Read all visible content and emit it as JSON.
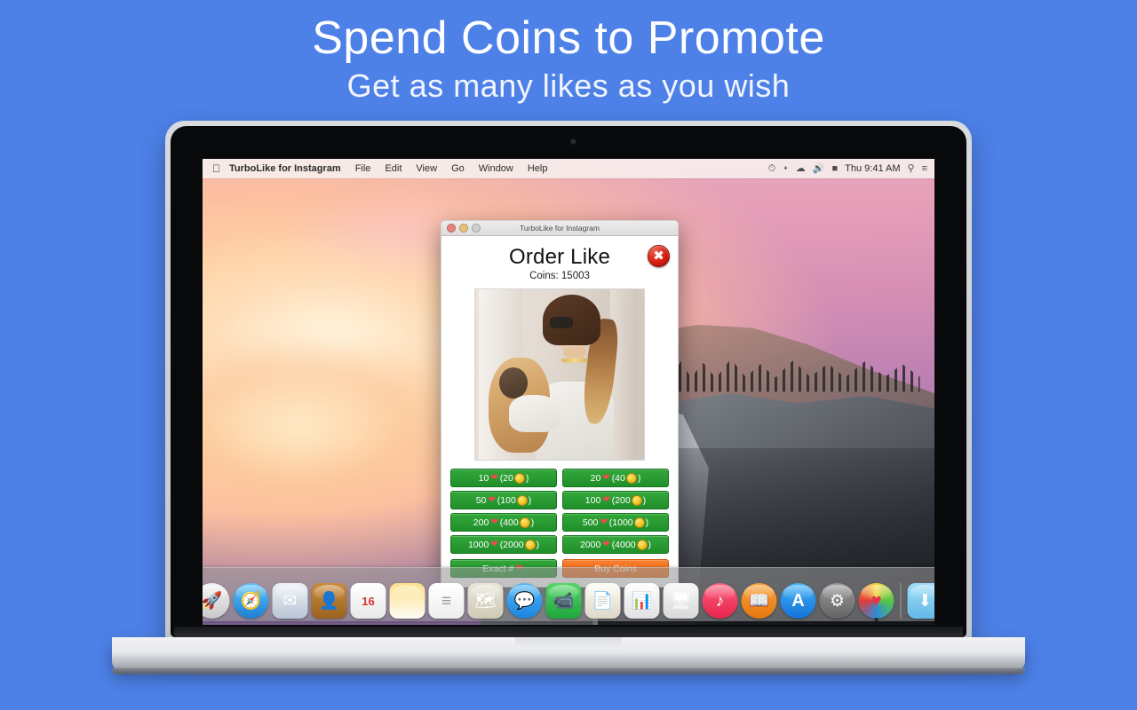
{
  "headline": {
    "line1": "Spend Coins to Promote",
    "line2": "Get as many likes as you wish"
  },
  "colors": {
    "background": "#4d81e8",
    "button_green": "#2a9c33",
    "button_orange": "#f4721d",
    "heart_red": "#ef4b4b",
    "coin_gold": "#f2c31f",
    "close_red": "#d81f12"
  },
  "menubar": {
    "apple": "",
    "app_name": "TurboLike for Instagram",
    "items": [
      "File",
      "Edit",
      "View",
      "Go",
      "Window",
      "Help"
    ],
    "status_icons": [
      "time-machine-icon",
      "bluetooth-icon",
      "wifi-icon",
      "volume-icon",
      "battery-icon"
    ],
    "clock": "Thu 9:41 AM",
    "right_icons": [
      "spotlight-search-icon",
      "notification-center-icon"
    ]
  },
  "window": {
    "title": "TurboLike for Instagram",
    "traffic_lights": [
      "close",
      "minimize",
      "zoom"
    ],
    "heading": "Order Like",
    "coins_label": "Coins: 15003",
    "close_button": "✖",
    "photo_alt": "woman with sunglasses and ponytail holding a small dog"
  },
  "order_options": [
    {
      "likes": "10",
      "price": "20",
      "left": "10",
      "right": "(20",
      "tail": ")"
    },
    {
      "likes": "20",
      "price": "40",
      "left": "20",
      "right": "(40",
      "tail": ")"
    },
    {
      "likes": "50",
      "price": "100",
      "left": "50",
      "right": "(100",
      "tail": ")"
    },
    {
      "likes": "100",
      "price": "200",
      "left": "100",
      "right": "(200",
      "tail": ")"
    },
    {
      "likes": "200",
      "price": "400",
      "left": "200",
      "right": "(400",
      "tail": ")"
    },
    {
      "likes": "500",
      "price": "1000",
      "left": "500",
      "right": "(1000",
      "tail": ")"
    },
    {
      "likes": "1000",
      "price": "2000",
      "left": "1000",
      "right": "(2000",
      "tail": ")"
    },
    {
      "likes": "2000",
      "price": "4000",
      "left": "2000",
      "right": "(4000",
      "tail": ")"
    }
  ],
  "actions": {
    "exact_label": "Exact  #",
    "buy_coins_label": "Buy Coins"
  },
  "dock": {
    "items": [
      {
        "name": "finder",
        "glyph": "☺",
        "bg": "linear-gradient(180deg,#3da8f5,#1b7fd6)",
        "shape": "rounded"
      },
      {
        "name": "launchpad",
        "glyph": "🚀",
        "bg": "linear-gradient(180deg,#f2f2f2,#c9c9c9)",
        "shape": "circle"
      },
      {
        "name": "safari",
        "glyph": "🧭",
        "bg": "linear-gradient(180deg,#5fc2f7,#1c7fd4)",
        "shape": "circle"
      },
      {
        "name": "mail",
        "glyph": "✉",
        "bg": "linear-gradient(180deg,#eef2f7,#b9c6d6)",
        "shape": "rounded"
      },
      {
        "name": "contacts",
        "glyph": "👤",
        "bg": "linear-gradient(180deg,#c98c3e,#9a631f)",
        "shape": "rounded"
      },
      {
        "name": "calendar",
        "glyph": "16",
        "bg": "linear-gradient(180deg,#ffffff,#e8e8e8)",
        "shape": "rounded"
      },
      {
        "name": "notes",
        "glyph": "",
        "bg": "linear-gradient(180deg,#fbe08a,#fdfcf4)",
        "shape": "rounded"
      },
      {
        "name": "reminders",
        "glyph": "≡",
        "bg": "linear-gradient(180deg,#ffffff,#ededed)",
        "shape": "rounded"
      },
      {
        "name": "maps",
        "glyph": "🗺",
        "bg": "linear-gradient(180deg,#e8e4d8,#cfcab6)",
        "shape": "rounded"
      },
      {
        "name": "messages",
        "glyph": "💬",
        "bg": "linear-gradient(180deg,#52b8f7,#1b84e0)",
        "shape": "circle"
      },
      {
        "name": "facetime",
        "glyph": "📹",
        "bg": "linear-gradient(180deg,#56d46a,#1fa63c)",
        "shape": "rounded"
      },
      {
        "name": "pages",
        "glyph": "📄",
        "bg": "linear-gradient(180deg,#fdfbf4,#ddd7c8)",
        "shape": "rounded"
      },
      {
        "name": "numbers",
        "glyph": "📊",
        "bg": "linear-gradient(180deg,#fdfdfd,#e2e2e2)",
        "shape": "rounded"
      },
      {
        "name": "keynote",
        "glyph": "🖥",
        "bg": "linear-gradient(180deg,#f7f7f7,#d8d8d8)",
        "shape": "rounded"
      },
      {
        "name": "itunes",
        "glyph": "♪",
        "bg": "linear-gradient(180deg,#fb5f7d,#e8244a)",
        "shape": "circle"
      },
      {
        "name": "ibooks",
        "glyph": "📖",
        "bg": "linear-gradient(180deg,#f9a33a,#e5770f)",
        "shape": "circle"
      },
      {
        "name": "app-store",
        "glyph": "A",
        "bg": "linear-gradient(180deg,#3fb2f7,#1472d8)",
        "shape": "circle"
      },
      {
        "name": "system-preferences",
        "glyph": "⚙",
        "bg": "linear-gradient(180deg,#9b9b9b,#636363)",
        "shape": "circle"
      },
      {
        "name": "turbolike",
        "glyph": "♥",
        "bg": "conic-gradient(#f5d93a,#56c44a,#2f8ad8,#e23b3b,#f5d93a)",
        "shape": "circle",
        "running": true
      }
    ],
    "extras": [
      {
        "name": "downloads-folder",
        "glyph": "⬇",
        "bg": "linear-gradient(180deg,#9fdcf7,#63b9e8)",
        "shape": "rounded"
      },
      {
        "name": "trash",
        "glyph": "",
        "bg": "linear-gradient(180deg,#f4f4f4,#cfd1d4)",
        "shape": "rounded"
      }
    ]
  }
}
